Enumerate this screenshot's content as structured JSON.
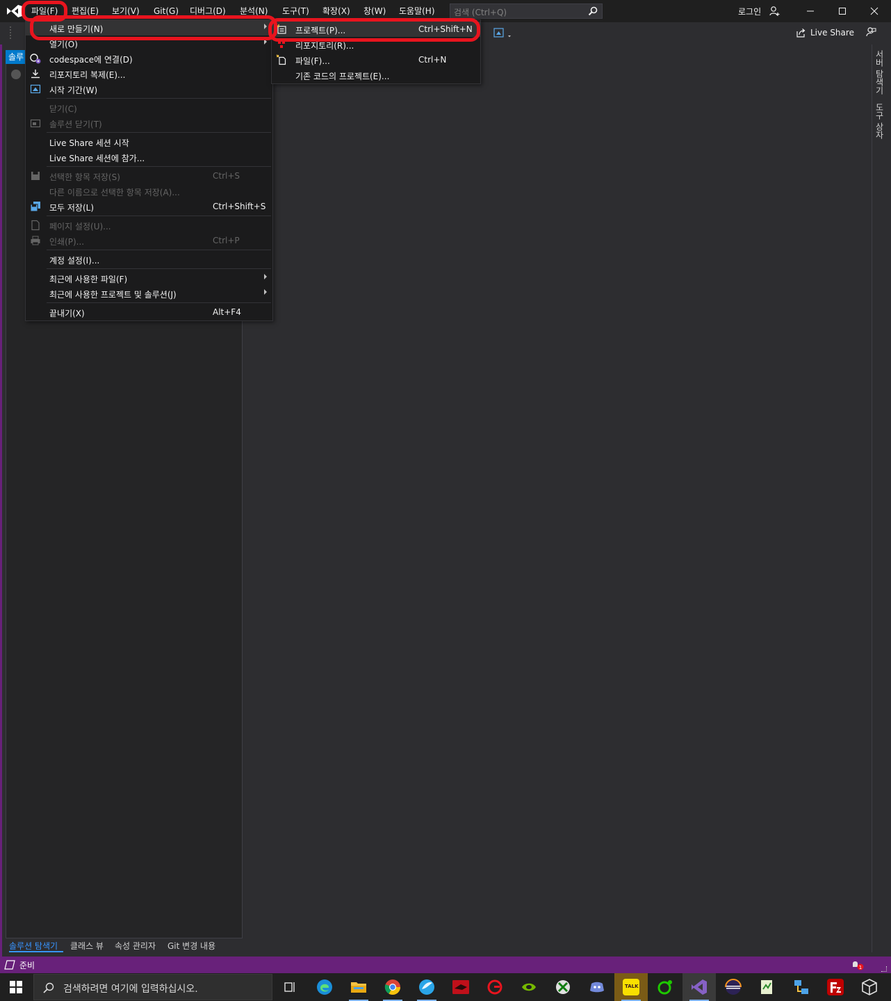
{
  "menubar": {
    "items": [
      "파일(F)",
      "편집(E)",
      "보기(V)",
      "Git(G)",
      "디버그(D)",
      "분석(N)",
      "도구(T)",
      "확장(X)",
      "창(W)",
      "도움말(H)"
    ],
    "search_placeholder": "검색 (Ctrl+Q)",
    "login": "로그인"
  },
  "toolbar": {
    "live_share": "Live Share"
  },
  "left_panel": {
    "tab_stub": "솔루",
    "bottom_tabs": [
      "솔루션 탐색기",
      "클래스 뷰",
      "속성 관리자",
      "Git 변경 내용"
    ]
  },
  "right_rail": {
    "tabs": [
      "서버 탐색기",
      "도구 상자"
    ]
  },
  "file_menu": {
    "items": [
      {
        "label": "새로 만들기(N)",
        "shortcut": "",
        "submenu": true,
        "disabled": false
      },
      {
        "label": "열기(O)",
        "shortcut": "",
        "submenu": true,
        "disabled": false
      },
      {
        "label": "codespace에 연결(D)",
        "shortcut": "",
        "submenu": false,
        "disabled": false
      },
      {
        "label": "리포지토리 복제(E)...",
        "shortcut": "",
        "submenu": false,
        "disabled": false
      },
      {
        "label": "시작 기간(W)",
        "shortcut": "",
        "submenu": false,
        "disabled": false
      },
      {
        "label": "닫기(C)",
        "shortcut": "",
        "submenu": false,
        "disabled": true
      },
      {
        "label": "솔루션 닫기(T)",
        "shortcut": "",
        "submenu": false,
        "disabled": true
      },
      {
        "label": "Live Share 세션 시작",
        "shortcut": "",
        "submenu": false,
        "disabled": false
      },
      {
        "label": "Live Share 세션에 참가...",
        "shortcut": "",
        "submenu": false,
        "disabled": false
      },
      {
        "label": "선택한 항목 저장(S)",
        "shortcut": "Ctrl+S",
        "submenu": false,
        "disabled": true
      },
      {
        "label": "다른 이름으로 선택한 항목 저장(A)...",
        "shortcut": "",
        "submenu": false,
        "disabled": true
      },
      {
        "label": "모두 저장(L)",
        "shortcut": "Ctrl+Shift+S",
        "submenu": false,
        "disabled": false
      },
      {
        "label": "페이지 설정(U)...",
        "shortcut": "",
        "submenu": false,
        "disabled": true
      },
      {
        "label": "인쇄(P)...",
        "shortcut": "Ctrl+P",
        "submenu": false,
        "disabled": true
      },
      {
        "label": "계정 설정(I)...",
        "shortcut": "",
        "submenu": false,
        "disabled": false
      },
      {
        "label": "최근에 사용한 파일(F)",
        "shortcut": "",
        "submenu": true,
        "disabled": false
      },
      {
        "label": "최근에 사용한 프로젝트 및 솔루션(J)",
        "shortcut": "",
        "submenu": true,
        "disabled": false
      },
      {
        "label": "끝내기(X)",
        "shortcut": "Alt+F4",
        "submenu": false,
        "disabled": false
      }
    ]
  },
  "new_submenu": {
    "items": [
      {
        "label": "프로젝트(P)...",
        "shortcut": "Ctrl+Shift+N"
      },
      {
        "label": "리포지토리(R)...",
        "shortcut": ""
      },
      {
        "label": "파일(F)...",
        "shortcut": "Ctrl+N"
      },
      {
        "label": "기존 코드의 프로젝트(E)...",
        "shortcut": ""
      }
    ]
  },
  "statusbar": {
    "text": "준비",
    "notification_count": "1"
  },
  "taskbar": {
    "search_placeholder": "검색하려면 여기에 입력하십시오.",
    "kakao_label": "TALK"
  },
  "colors": {
    "accent": "#007acc",
    "status": "#68217a",
    "highlight_ring": "#e8141e"
  }
}
